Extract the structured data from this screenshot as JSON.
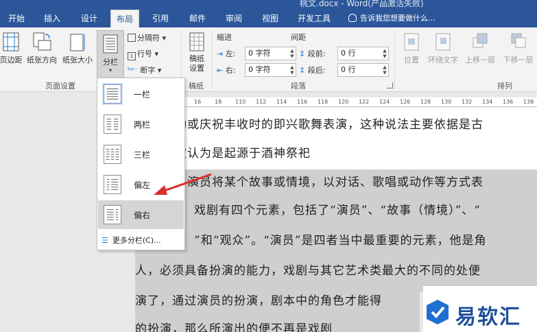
{
  "window": {
    "title": "桃文.docx - Word(产品激活失败)"
  },
  "tabs": [
    {
      "label": "开始"
    },
    {
      "label": "插入"
    },
    {
      "label": "设计"
    },
    {
      "label": "布局"
    },
    {
      "label": "引用"
    },
    {
      "label": "邮件"
    },
    {
      "label": "审阅"
    },
    {
      "label": "视图"
    },
    {
      "label": "开发工具"
    }
  ],
  "tell_me": "告诉我您想要做什么...",
  "ribbon": {
    "page_setup": {
      "margins": "页边距",
      "orientation": "纸张方向",
      "size": "纸张大小",
      "columns": "分栏",
      "breaks": "分隔符",
      "line_numbers": "行号",
      "hyphenation": "断字",
      "group": "页面设置"
    },
    "draft": {
      "button": "稿纸\n设置",
      "group": "稿纸"
    },
    "paragraph": {
      "indent": "缩进",
      "spacing": "间距",
      "left": "左:",
      "right": "右:",
      "before": "段前:",
      "after": "段后:",
      "left_val": "0 字符",
      "right_val": "0 字符",
      "before_val": "0 行",
      "after_val": "0 行",
      "group": "段落"
    },
    "arrange": {
      "position": "位置",
      "wrap": "环绕文字",
      "forward": "上移一层",
      "backward": "下移一层",
      "group": "排列"
    }
  },
  "ruler": [
    "16",
    "18",
    "110",
    "112",
    "114",
    "116",
    "118",
    "120",
    "122",
    "124",
    "126",
    "128",
    "130",
    "132",
    "134",
    "136",
    "138"
  ],
  "doc_lines": [
    "动或庆祝丰收时的即兴歌舞表演，这种说法主要依据是古",
    "被认为是起源于酒神祭祀",
    "由演员将某个故事或情境，以对话、歌唱或动作等方式表",
    "戏剧有四个元素，包括了“演员”、“故事（情境）”、“",
    "”和“观众”。“演员”是四者当中最重要的元素，他是角",
    "人，必须具备扮演的能力，戏剧与其它艺术类最大的不同的处便",
    "演了，通过演员的扮演，剧本中的角色才能得",
    "的扮演，那么所演出的便不再是戏剧"
  ],
  "columns_menu": {
    "items": [
      {
        "label": "一栏"
      },
      {
        "label": "两栏"
      },
      {
        "label": "三栏"
      },
      {
        "label": "偏左"
      },
      {
        "label": "偏右"
      }
    ],
    "more": "更多分栏(C)..."
  },
  "watermark": {
    "text": "易软汇"
  },
  "colors": {
    "accent": "#2b579a",
    "arrow": "#d9302b"
  }
}
